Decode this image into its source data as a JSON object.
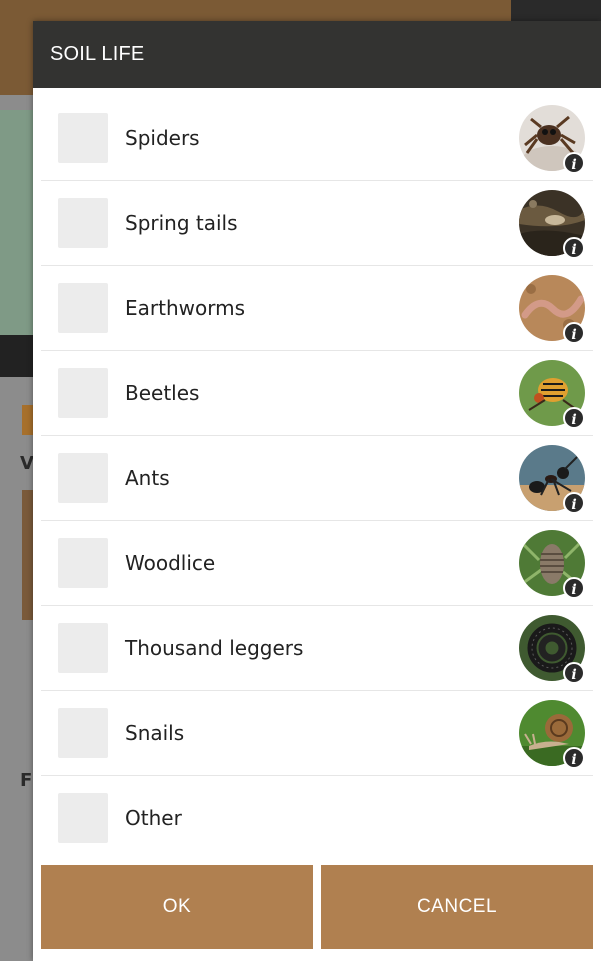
{
  "dialog": {
    "title": "SOIL LIFE",
    "items": [
      {
        "label": "Spiders",
        "icon": "spider-image"
      },
      {
        "label": "Spring tails",
        "icon": "springtail-image"
      },
      {
        "label": "Earthworms",
        "icon": "earthworm-image"
      },
      {
        "label": "Beetles",
        "icon": "beetle-image"
      },
      {
        "label": "Ants",
        "icon": "ant-image"
      },
      {
        "label": "Woodlice",
        "icon": "woodlouse-image"
      },
      {
        "label": "Thousand leggers",
        "icon": "millipede-image"
      },
      {
        "label": "Snails",
        "icon": "snail-image"
      },
      {
        "label": "Other"
      }
    ],
    "ok_label": "OK",
    "cancel_label": "CANCEL",
    "info_glyph": "i"
  },
  "background": {
    "letter_w": "V",
    "letter_f": "F"
  },
  "colors": {
    "header": "#333331",
    "button": "#b08050",
    "checkbox": "#ececec"
  }
}
